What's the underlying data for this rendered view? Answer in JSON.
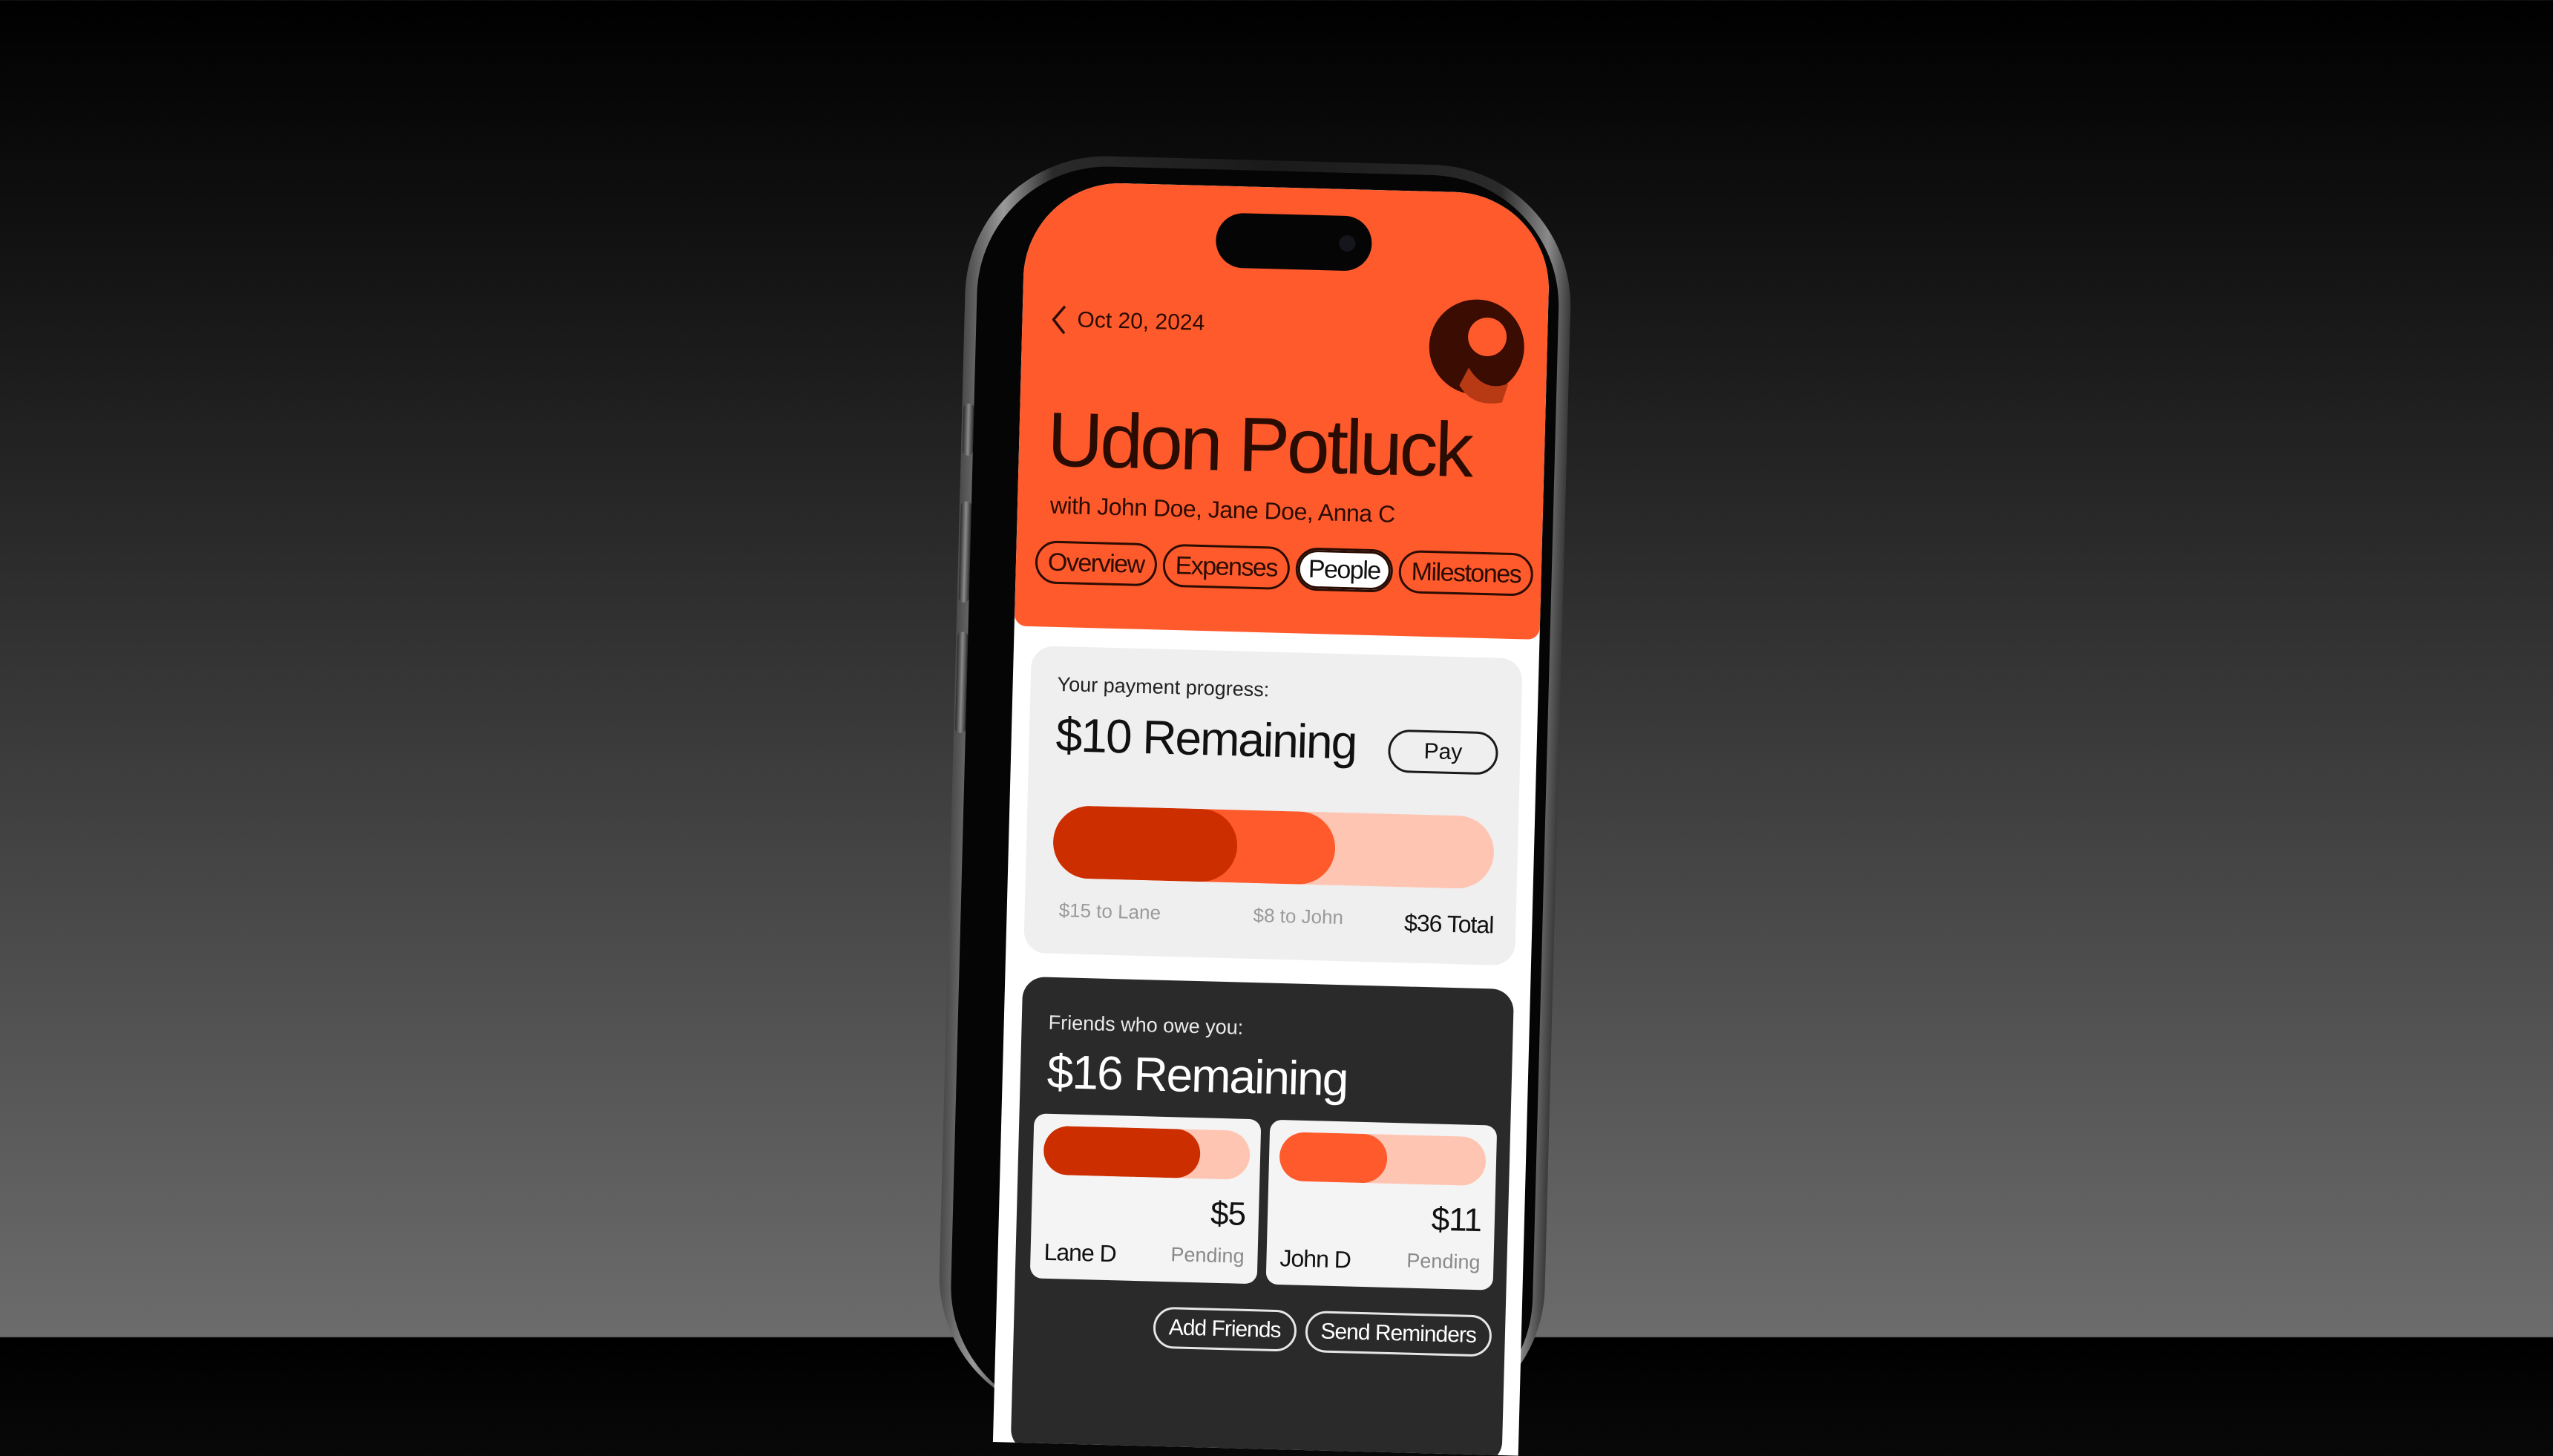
{
  "colors": {
    "accent": "#ff5a2c",
    "accent_dark": "#cc2e00",
    "accent_light": "#ffc5b3",
    "ink": "#2a0c02",
    "card_dark": "#2a2a2a",
    "card_light": "#efefef"
  },
  "header": {
    "back_icon": "chevron-left-icon",
    "date": "Oct 20, 2024",
    "logo_icon": "app-logo-icon",
    "title": "Udon Potluck",
    "subtitle": "with John Doe, Jane Doe, Anna C",
    "tabs": [
      {
        "label": "Overview",
        "active": false
      },
      {
        "label": "Expenses",
        "active": false
      },
      {
        "label": "People",
        "active": true
      },
      {
        "label": "Milestones",
        "active": false
      }
    ]
  },
  "payment_progress": {
    "label": "Your payment progress:",
    "remaining": "$10 Remaining",
    "pay_label": "Pay",
    "segments": [
      {
        "label": "$15 to Lane",
        "value": 15
      },
      {
        "label": "$8 to John",
        "value": 8
      }
    ],
    "total_value": 36,
    "total_label": "$36 Total"
  },
  "friends": {
    "label": "Friends who owe you:",
    "remaining": "$16 Remaining",
    "items": [
      {
        "name": "Lane D",
        "amount": "$5",
        "status": "Pending",
        "progress": 0.76
      },
      {
        "name": "John D",
        "amount": "$11",
        "status": "Pending",
        "progress": 0.52
      }
    ],
    "add_friends_label": "Add Friends",
    "send_reminders_label": "Send Reminders"
  }
}
